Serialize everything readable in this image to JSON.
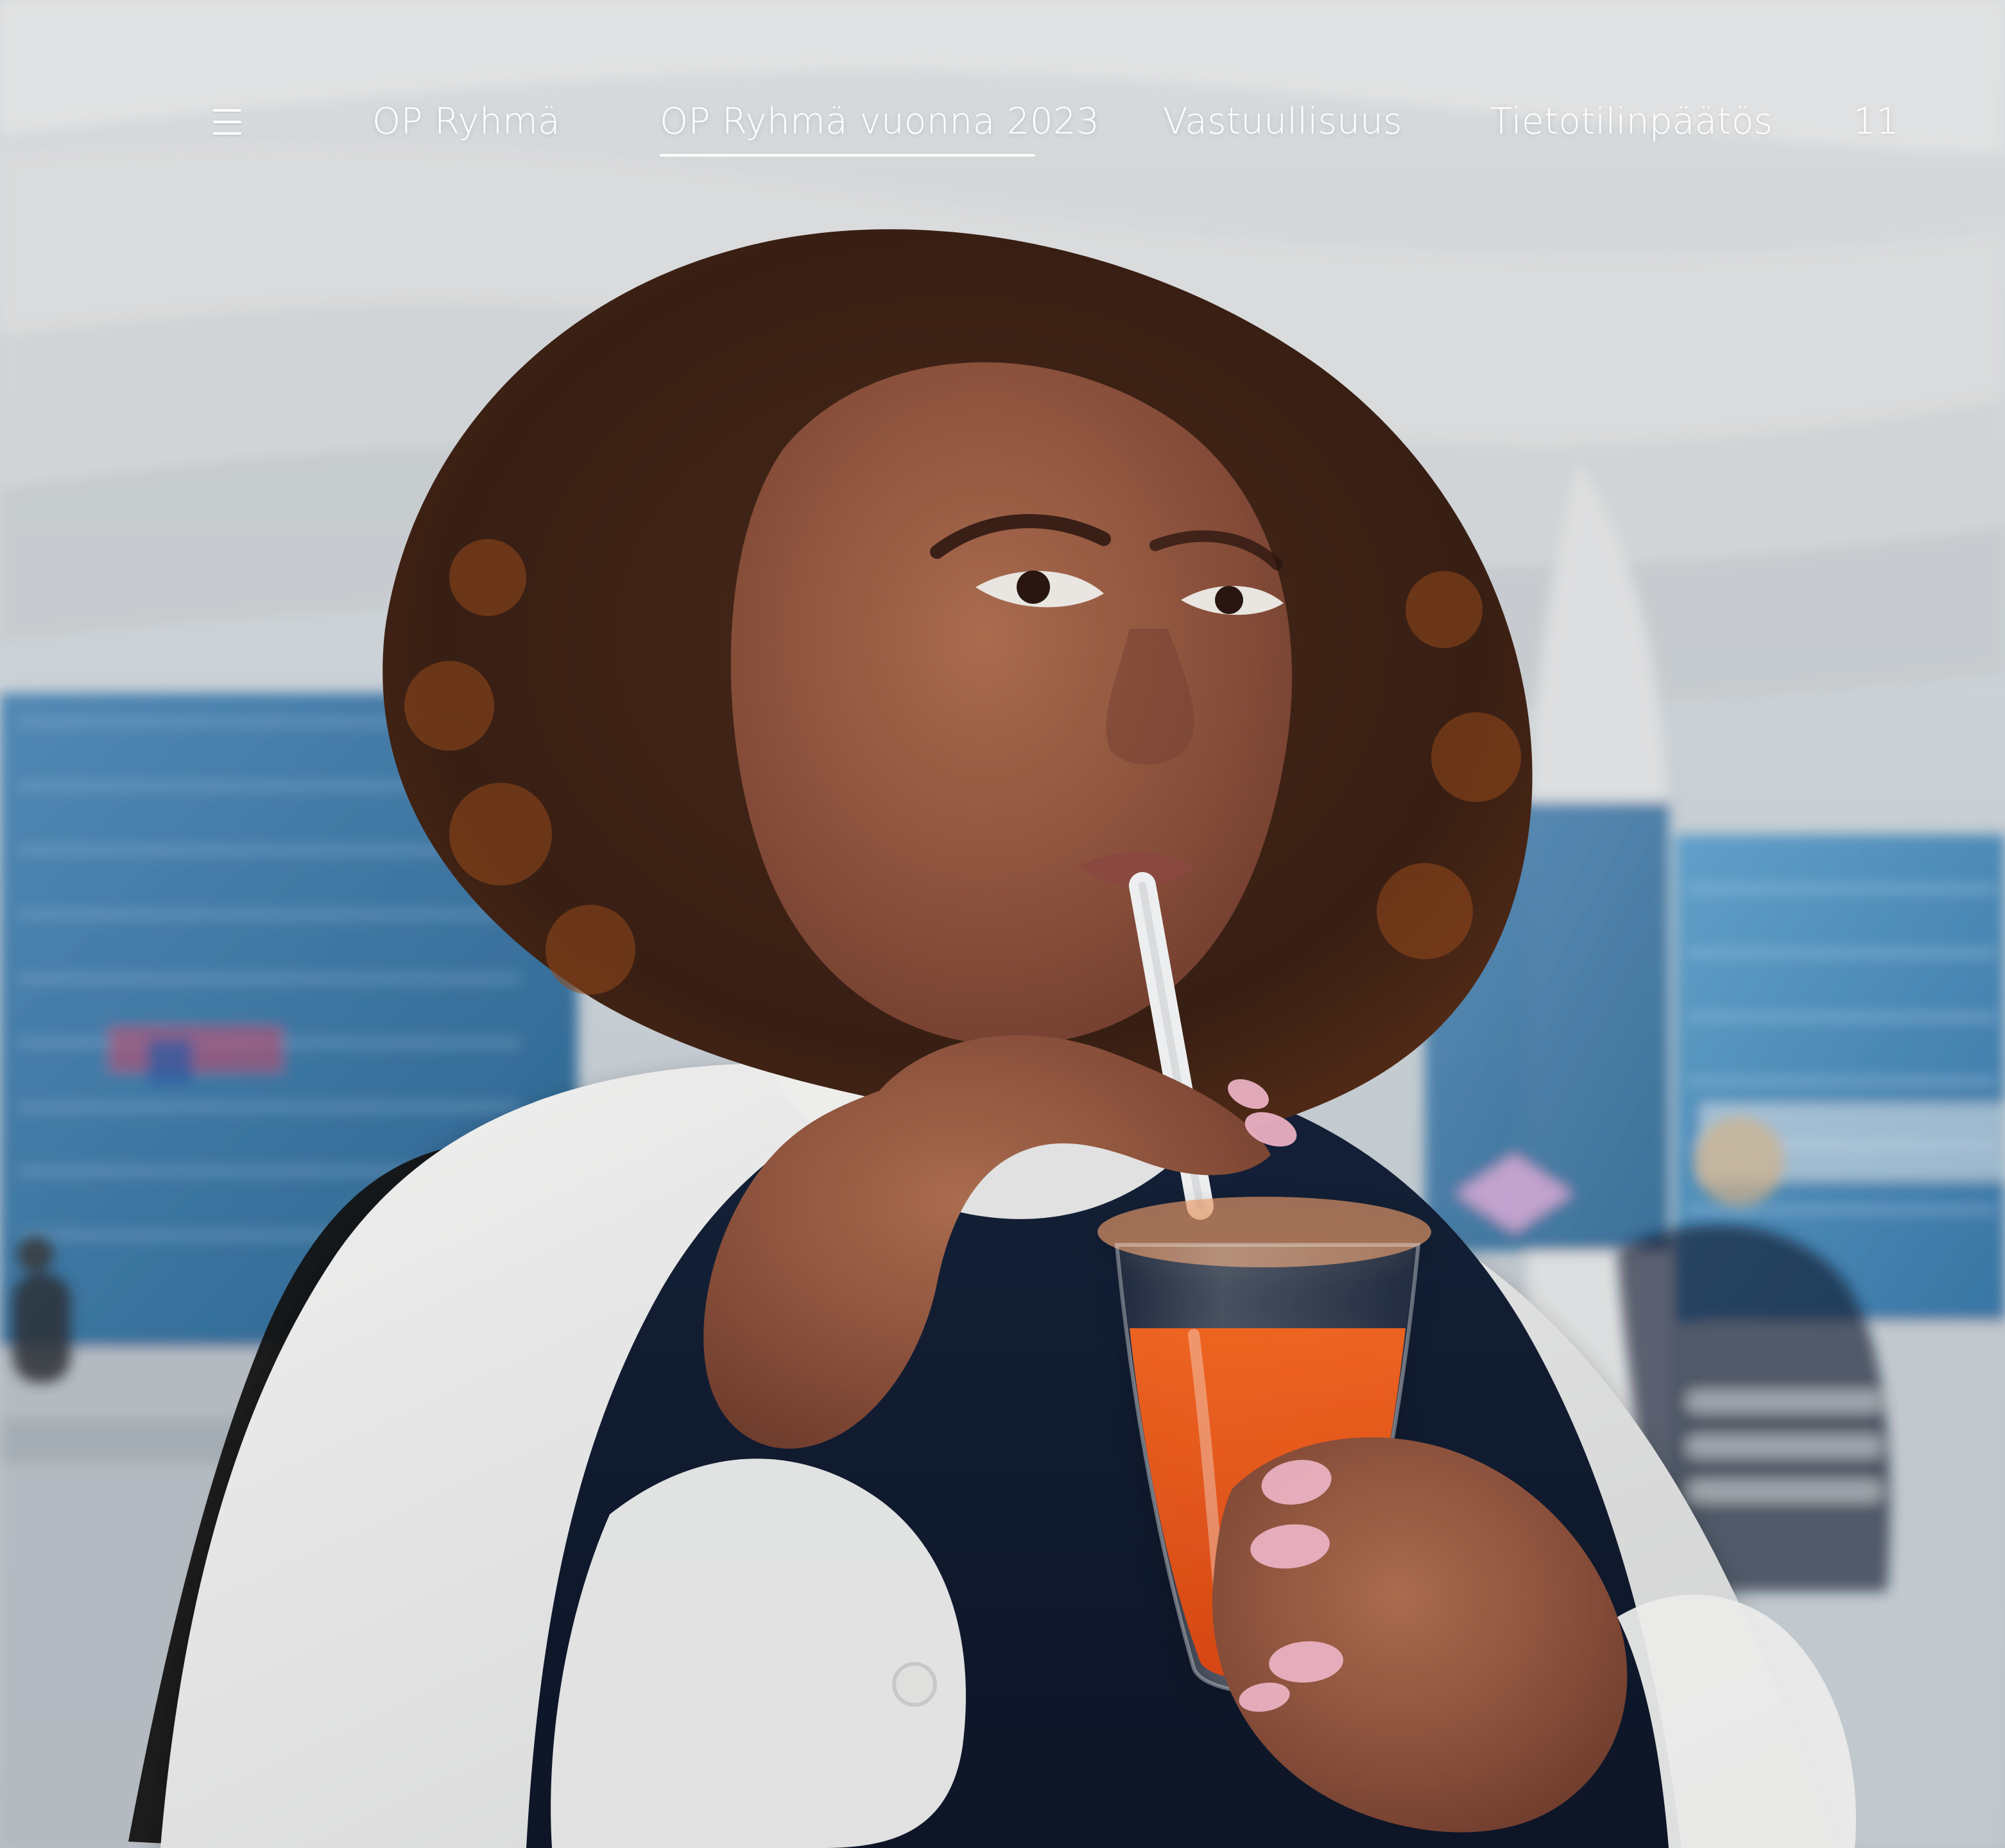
{
  "nav": {
    "menu_icon": "hamburger-menu-icon",
    "items": [
      {
        "label": "OP Ryhmä",
        "active": false
      },
      {
        "label": "OP Ryhmä vuonna 2023",
        "active": true
      },
      {
        "label": "Vastuullisuus",
        "active": false
      },
      {
        "label": "Tietotilinpäätös",
        "active": false
      }
    ],
    "page_number": "11"
  },
  "colors": {
    "nav_text": "#ffffff",
    "accent_underline": "#ffffff"
  }
}
